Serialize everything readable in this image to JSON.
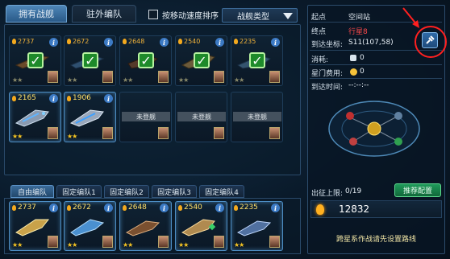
{
  "tabs": {
    "owned": "拥有战舰",
    "stationed": "驻外编队"
  },
  "sort_label": "按移动速度排序",
  "type_dropdown": "战舰类型",
  "owned_slots": [
    {
      "power": "2737",
      "checked": true,
      "stars": "★★"
    },
    {
      "power": "2672",
      "checked": true,
      "stars": "★★"
    },
    {
      "power": "2648",
      "checked": true,
      "stars": "★★"
    },
    {
      "power": "2540",
      "checked": true,
      "stars": "★★"
    },
    {
      "power": "2235",
      "checked": true,
      "stars": "★★"
    },
    {
      "power": "2165",
      "checked": false,
      "stars": "★★"
    },
    {
      "power": "1906",
      "checked": false,
      "stars": "★★"
    },
    {
      "empty": "未登舰"
    },
    {
      "empty": "未登舰"
    },
    {
      "empty": "未登舰"
    }
  ],
  "formation_tabs": [
    "自由编队",
    "固定编队1",
    "固定编队2",
    "固定编队3",
    "固定编队4"
  ],
  "formation_slots": [
    {
      "power": "2737",
      "stars": "★★"
    },
    {
      "power": "2672",
      "stars": "★★"
    },
    {
      "power": "2648",
      "stars": "★★"
    },
    {
      "power": "2540",
      "stars": "★★"
    },
    {
      "power": "2235",
      "stars": "★★"
    }
  ],
  "route": {
    "origin_label": "起点",
    "origin_value": "空间站",
    "dest_label": "终点",
    "dest_value": "行星8",
    "coord_label": "到达坐标:",
    "coord_value": "S11(107,58)",
    "cost_label": "消耗:",
    "cost_value": "0",
    "gate_label": "星门费用:",
    "gate_value": "0",
    "time_label": "到达时间:",
    "time_value": "--:--:--"
  },
  "launch_limit_label": "出征上限:",
  "launch_limit_value": "0/19",
  "recommend_button": "推荐配置",
  "total_power": "12832",
  "hint": "跨星系作战请先设置路线",
  "icons": {
    "info": "i",
    "check": "✓",
    "route_button_icon": "satellite-icon"
  },
  "colors": {
    "accent": "#3c7ac4",
    "check_green": "#1e8a2a",
    "power_gold": "#f0b23a",
    "highlight_red": "#ff2020"
  }
}
